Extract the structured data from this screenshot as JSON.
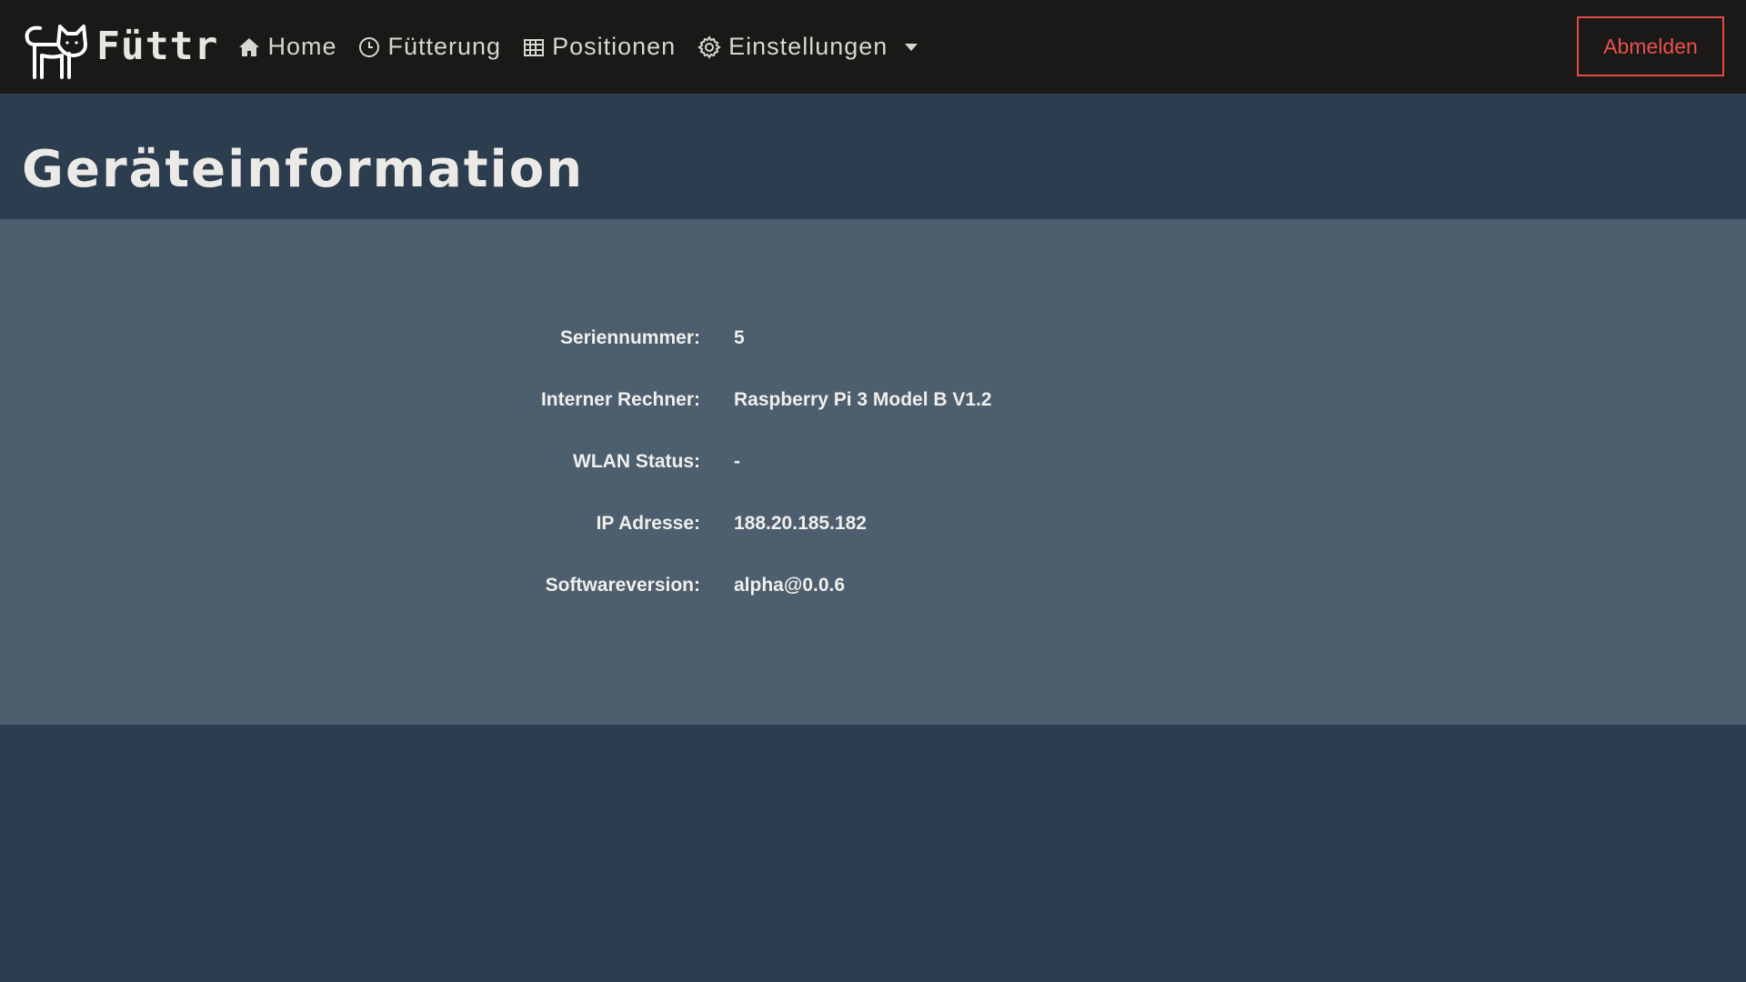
{
  "brand": {
    "name": "Füttr",
    "logo_icon": "cat-icon"
  },
  "nav": {
    "items": [
      {
        "label": "Home",
        "icon": "home-icon"
      },
      {
        "label": "Fütterung",
        "icon": "clock-icon"
      },
      {
        "label": "Positionen",
        "icon": "grid-icon"
      },
      {
        "label": "Einstellungen",
        "icon": "gear-icon",
        "dropdown_icon": "caret-down-icon"
      }
    ],
    "logout_label": "Abmelden"
  },
  "page": {
    "title": "Geräteinformation"
  },
  "device_info": {
    "rows": [
      {
        "label": "Seriennummer:",
        "value": "5"
      },
      {
        "label": "Interner Rechner:",
        "value": "Raspberry Pi 3 Model B V1.2"
      },
      {
        "label": "WLAN Status:",
        "value": "-"
      },
      {
        "label": "IP Adresse:",
        "value": "188.20.185.182"
      },
      {
        "label": "Softwareversion:",
        "value": "alpha@0.0.6"
      }
    ]
  },
  "colors": {
    "navbar_bg": "#1a1917",
    "page_bg": "#2b3d4f",
    "panel_bg": "#4d5e6e",
    "logout_accent": "#e04a48",
    "text_light": "#eceae6"
  }
}
